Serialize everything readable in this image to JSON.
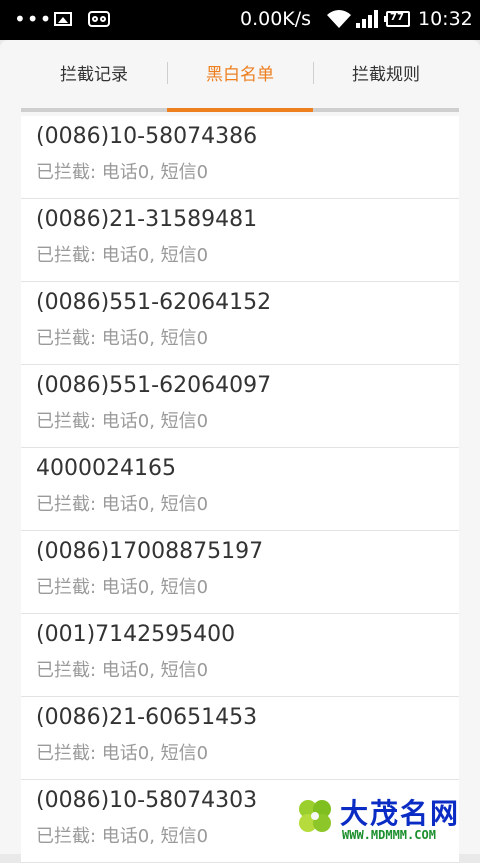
{
  "status_bar": {
    "dots": "•••",
    "net_speed": "0.00K/s",
    "battery": "77",
    "time": "10:32"
  },
  "tabs": [
    {
      "label": "拦截记录",
      "active": false
    },
    {
      "label": "黑白名单",
      "active": true
    },
    {
      "label": "拦截规则",
      "active": false
    }
  ],
  "blacklist": [
    {
      "number": "(0086)10-58074386",
      "stats": "已拦截: 电话0, 短信0"
    },
    {
      "number": "(0086)21-31589481",
      "stats": "已拦截: 电话0, 短信0"
    },
    {
      "number": "(0086)551-62064152",
      "stats": "已拦截: 电话0, 短信0"
    },
    {
      "number": "(0086)551-62064097",
      "stats": "已拦截: 电话0, 短信0"
    },
    {
      "number": "4000024165",
      "stats": "已拦截: 电话0, 短信0"
    },
    {
      "number": "(0086)17008875197",
      "stats": "已拦截: 电话0, 短信0"
    },
    {
      "number": "(001)7142595400",
      "stats": "已拦截: 电话0, 短信0"
    },
    {
      "number": "(0086)21-60651453",
      "stats": "已拦截: 电话0, 短信0"
    },
    {
      "number": "(0086)10-58074303",
      "stats": "已拦截: 电话0, 短信0"
    }
  ],
  "watermark": {
    "title": "大茂名网",
    "url": "WWW.MDMMM.COM"
  },
  "colors": {
    "accent": "#ee7f1f",
    "background": "#f6f6f6"
  }
}
